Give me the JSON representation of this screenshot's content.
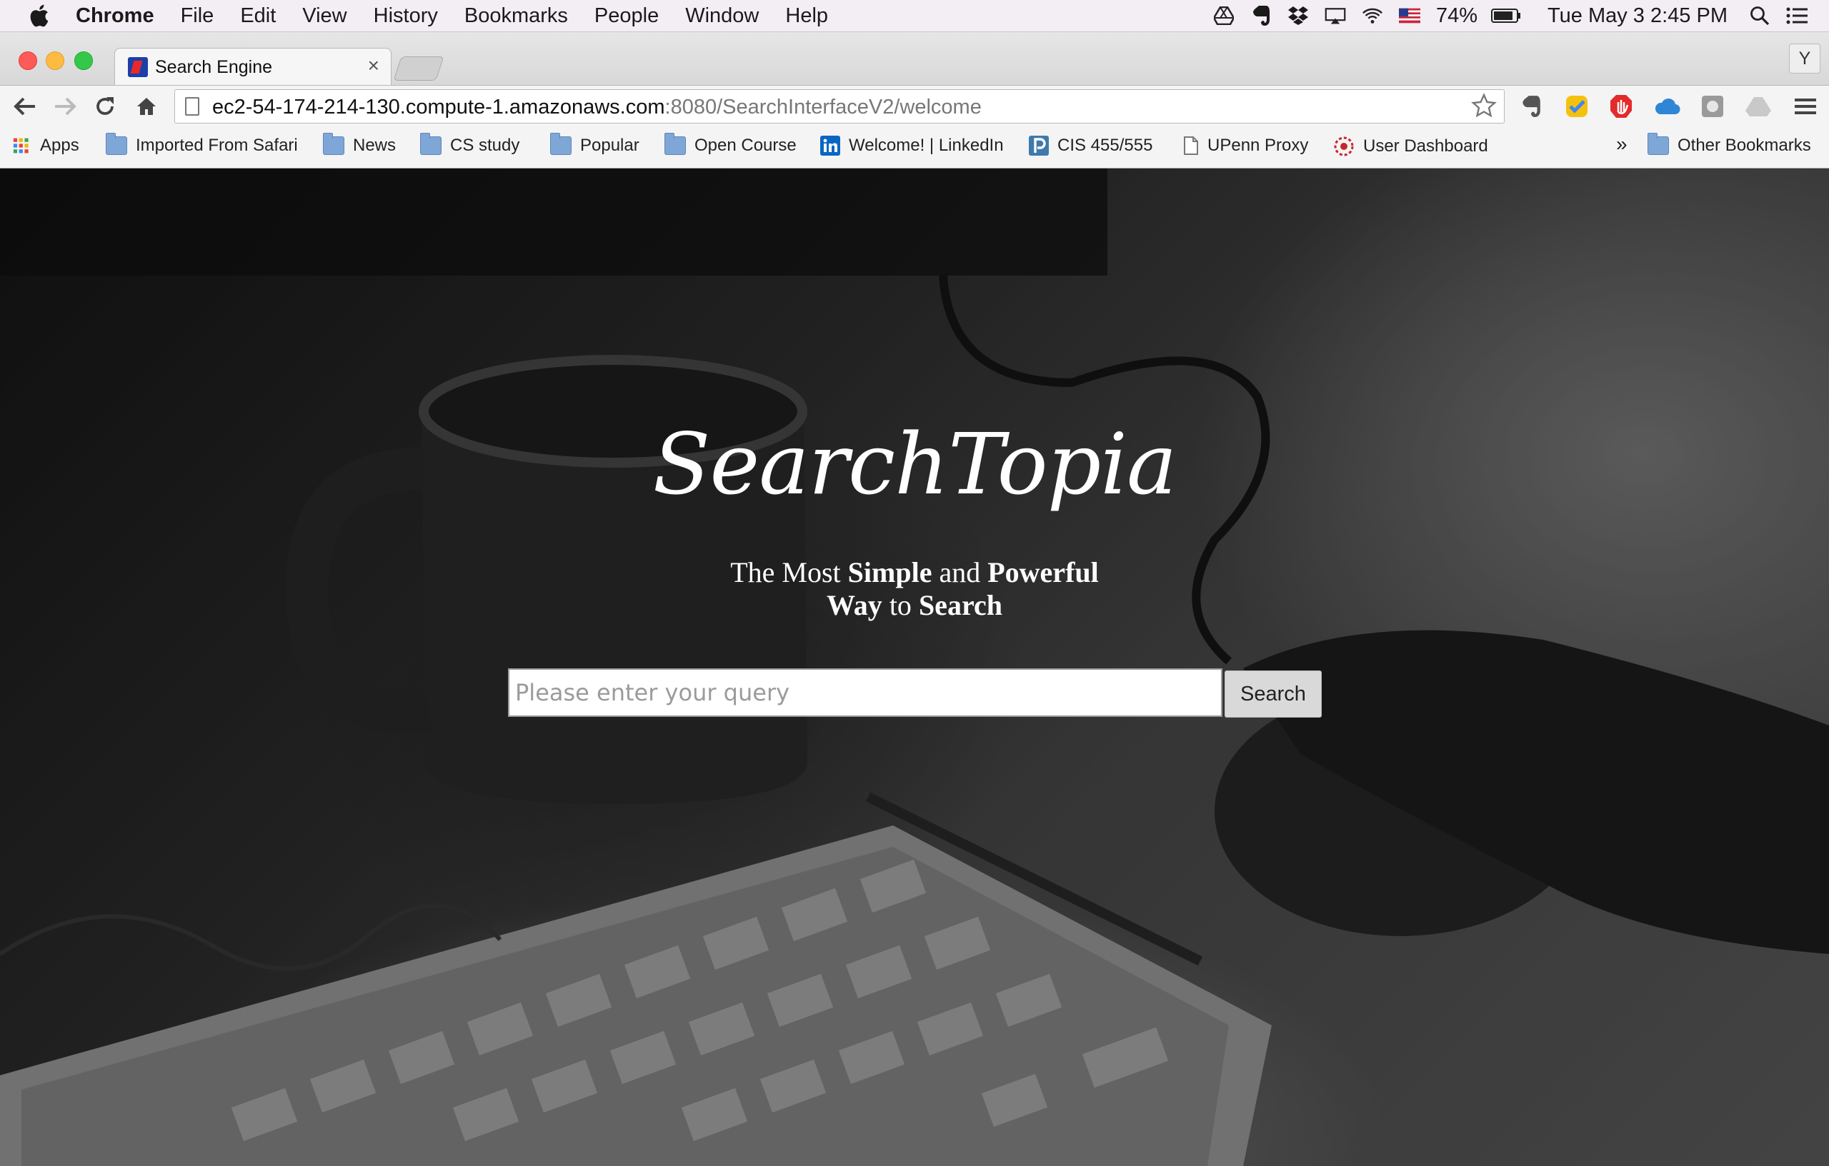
{
  "menubar": {
    "app_name": "Chrome",
    "items": [
      "File",
      "Edit",
      "View",
      "History",
      "Bookmarks",
      "People",
      "Window",
      "Help"
    ],
    "battery": "74%",
    "clock": "Tue May 3  2:45 PM"
  },
  "browser": {
    "tab_title": "Search Engine",
    "tab_close": "×",
    "profile_initial": "Y",
    "url_host": "ec2-54-174-214-130.compute-1.amazonaws.com",
    "url_path": ":8080/SearchInterfaceV2/welcome"
  },
  "bookmarks": {
    "items": [
      {
        "label": "Apps",
        "icon": "apps-grid-icon"
      },
      {
        "label": "Imported From Safari",
        "icon": "folder-icon"
      },
      {
        "label": "News",
        "icon": "folder-icon"
      },
      {
        "label": "CS study",
        "icon": "folder-icon"
      },
      {
        "label": "Popular",
        "icon": "folder-icon"
      },
      {
        "label": "Open Course",
        "icon": "folder-icon"
      },
      {
        "label": "Welcome! | LinkedIn",
        "icon": "linkedin-icon"
      },
      {
        "label": "CIS 455/555",
        "icon": "piazza-icon"
      },
      {
        "label": "UPenn Proxy",
        "icon": "page-icon"
      },
      {
        "label": "User Dashboard",
        "icon": "dashboard-icon"
      }
    ],
    "overflow": "»",
    "other": "Other Bookmarks"
  },
  "page": {
    "logo": "SearchTopia",
    "tagline": {
      "w1": "The Most ",
      "w2": "Simple",
      "w3": " and ",
      "w4": "Powerful",
      "w5": "Way",
      "w6": " to ",
      "w7": "Search"
    },
    "search": {
      "placeholder": "Please enter your query",
      "value": "",
      "button": "Search"
    }
  },
  "colors": {
    "menubar_bg": "#f3eef3",
    "chrome_toolbar": "#f4f4f4",
    "page_text": "#ffffff",
    "search_button_bg": "#d9d9d9"
  }
}
